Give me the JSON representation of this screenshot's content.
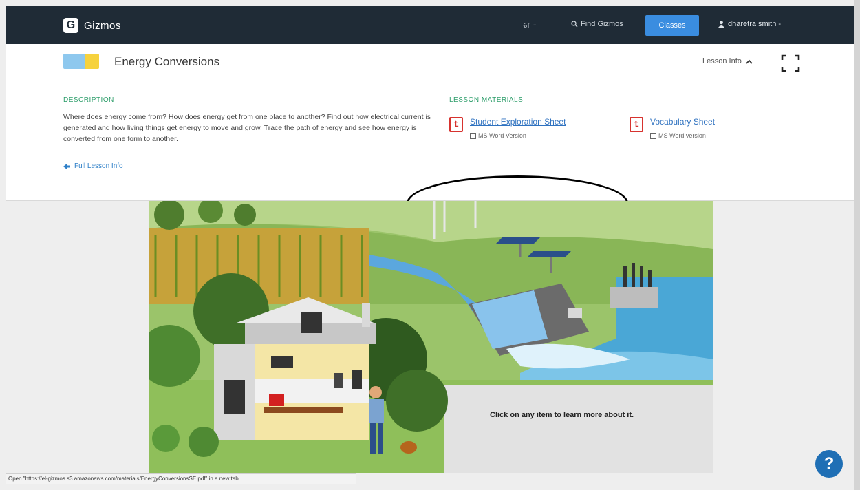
{
  "nav": {
    "logo_letter": "G",
    "app_name": "Gizmos",
    "lang_label": "எ -",
    "find_gizmos": "Find Gizmos",
    "classes_label": "Classes",
    "user_name": "dharetra smith -",
    "accent": "#3a8de0",
    "bar_color": "#1f2b36"
  },
  "lesson": {
    "title": "Energy Conversions",
    "lesson_info_label": "Lesson Info",
    "description_heading": "DESCRIPTION",
    "description": "Where does energy come from? How does energy get from one place to another? Find out how electrical current is generated and how living things get energy to move and grow. Trace the path of energy and see how energy is converted from one form to another.",
    "full_lesson_info": "Full Lesson Info",
    "materials_heading": "LESSON MATERIALS",
    "materials": [
      {
        "title": "Student Exploration Sheet",
        "sub": "MS Word Version"
      },
      {
        "title": "Vocabulary Sheet",
        "sub": "MS Word version"
      }
    ]
  },
  "scene": {
    "instruction": "Click on any item to learn more about it."
  },
  "status_bar": "Open \"https://el-gizmos.s3.amazonaws.com/materials/EnergyConversionsSE.pdf\" in a new tab",
  "help_label": "?"
}
